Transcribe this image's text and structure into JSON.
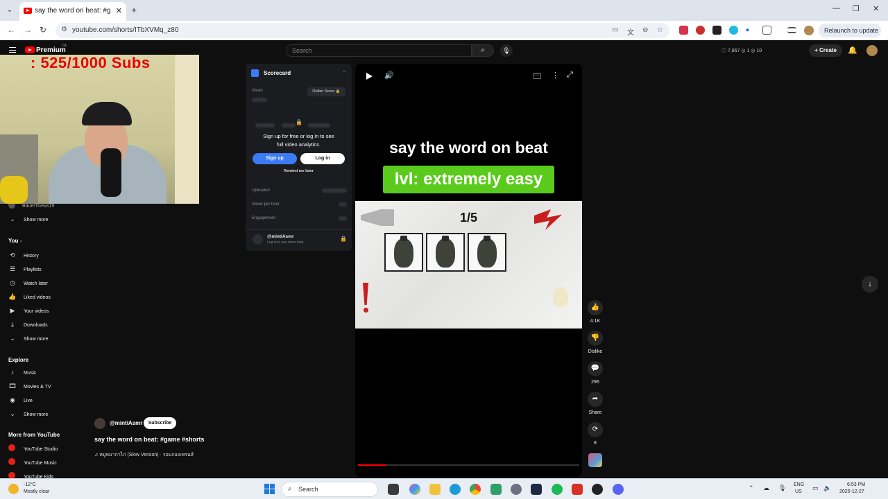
{
  "browser": {
    "tab_title": "say the word on beat: #game #",
    "url": "youtube.com/shorts/ITbXVMq_z80",
    "relaunch_label": "Relaunch to update"
  },
  "youtube": {
    "logo_text": "Premium",
    "country_code": "CA",
    "search_placeholder": "Search",
    "stats": "ⓘ 7,867 ◎ 1 ◎ 10",
    "create_label": "Create"
  },
  "overlay": {
    "subs_counter": ": 525/1000  Subs"
  },
  "sidebar": {
    "partial_item": "BauerToews19",
    "show_more": "Show more",
    "you_heading": "You",
    "you_items": [
      {
        "label": "History",
        "icon": "history-icon"
      },
      {
        "label": "Playlists",
        "icon": "playlists-icon"
      },
      {
        "label": "Watch later",
        "icon": "watch-later-icon"
      },
      {
        "label": "Liked videos",
        "icon": "liked-icon"
      },
      {
        "label": "Your videos",
        "icon": "your-videos-icon"
      },
      {
        "label": "Downloads",
        "icon": "downloads-icon"
      }
    ],
    "explore_heading": "Explore",
    "explore_items": [
      {
        "label": "Music",
        "icon": "music-icon"
      },
      {
        "label": "Movies & TV",
        "icon": "movies-icon"
      },
      {
        "label": "Live",
        "icon": "live-icon"
      }
    ],
    "more_heading": "More from YouTube",
    "more_items": [
      {
        "label": "YouTube Studio"
      },
      {
        "label": "YouTube Music"
      },
      {
        "label": "YouTube Kids"
      }
    ]
  },
  "scorecard": {
    "title": "Scorecard",
    "views_label": "Views",
    "outlier_label": "Outlier Score 🔒",
    "signup_message": "Sign up for free or log in to see full video analytics.",
    "signup_button": "Sign up",
    "login_button": "Log in",
    "remind_label": "Remind me later",
    "uploaded_label": "Uploaded",
    "vph_label": "Views per hour",
    "engagement_label": "Engagement",
    "account_name": "@mintiAsmr",
    "account_sub": "Log in to see more data"
  },
  "video": {
    "caption_line1": "say the word on beat",
    "caption_line2": "lvl: extremely easy",
    "round_counter": "1/5",
    "progress": 0.13
  },
  "actions": {
    "like_count": "4.1K",
    "dislike_label": "Dislike",
    "comments_count": "296",
    "share_label": "Share",
    "remix_count": "8"
  },
  "meta": {
    "channel": "@mintiAsmr",
    "subscribe_label": "Subscribe",
    "title": "say the word on beat: #game #shorts",
    "audio": "♫ หมูหมากาไก่ (Slow Version) · รอบกองเพรนส์"
  },
  "taskbar": {
    "temperature": "-12°C",
    "weather": "Mostly clear",
    "search_label": "Search",
    "lang": "ENG",
    "region": "US",
    "time": "6:53 PM",
    "date": "2025-12-27"
  },
  "colors": {
    "accent_red": "#ff0000",
    "scorecard_blue": "#3b7cf6",
    "caption_green": "#5acb1c"
  }
}
